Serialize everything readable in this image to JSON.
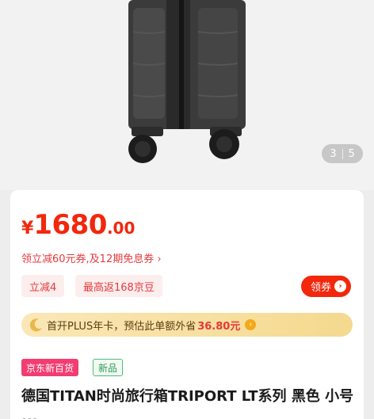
{
  "gallery": {
    "current": "3",
    "total": "5"
  },
  "price": {
    "currency": "¥",
    "integer": "1680",
    "decimal": ".00"
  },
  "promo": {
    "text": "领立减60元券,及12期免息券 ›"
  },
  "tags": [
    "立减4",
    "最高返168京豆"
  ],
  "coupon_button": {
    "label": "领券",
    "arrow": "›"
  },
  "plus_bar": {
    "text": "首开PLUS年卡，预估此单额外省",
    "amount": "36.80元",
    "coin": "›"
  },
  "badges": [
    "京东新百货",
    "新品"
  ],
  "product_title": "德国TITAN时尚旅行箱TRIPORT LT系列 黑色 小号 ..."
}
